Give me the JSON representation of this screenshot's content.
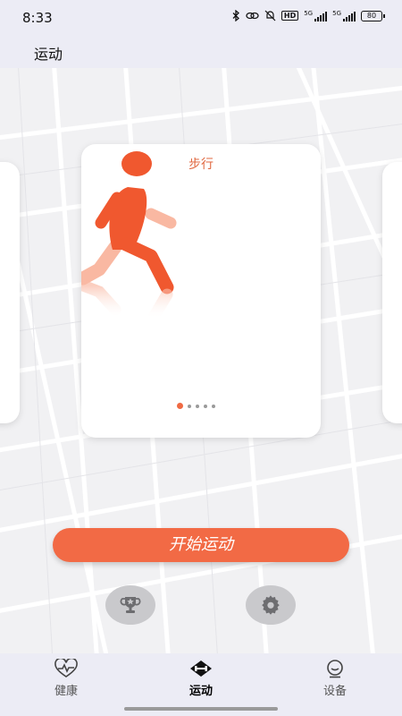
{
  "status_bar": {
    "time": "8:33",
    "network_1": "5G",
    "network_2": "5G",
    "hd": "HD",
    "battery": "80"
  },
  "header": {
    "title": "运动"
  },
  "carousel": {
    "current_card_title": "步行",
    "current_icon": "walking-person-icon",
    "page_count": 5,
    "active_index": 0
  },
  "actions": {
    "start_label": "开始运动",
    "trophy_icon": "trophy-icon",
    "settings_icon": "gear-icon"
  },
  "tabs": [
    {
      "label": "健康",
      "icon": "heart-pulse-icon",
      "active": false
    },
    {
      "label": "运动",
      "icon": "dumbbell-icon",
      "active": true
    },
    {
      "label": "设备",
      "icon": "device-face-icon",
      "active": false
    }
  ],
  "colors": {
    "accent": "#f26a45",
    "card_title": "#e0673f",
    "bar_bg": "#ececf5"
  }
}
